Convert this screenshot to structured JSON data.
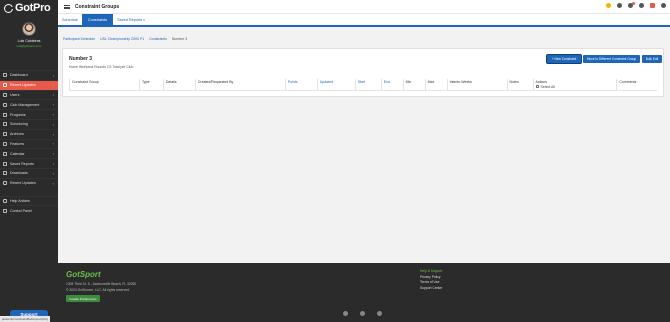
{
  "sidebar": {
    "logo_text": "GotPro",
    "user_name": "Luis Caldeiras",
    "user_email": "luis@gotsport.com",
    "items": [
      {
        "label": "Dashboard",
        "icon": "grid-icon",
        "active": false
      },
      {
        "label": "Recent Updates",
        "icon": "clock-icon",
        "active": true
      },
      {
        "label": "Users",
        "icon": "users-icon",
        "active": false
      },
      {
        "label": "Club Management",
        "icon": "shield-icon",
        "active": false
      },
      {
        "label": "Programs",
        "icon": "flag-icon",
        "active": false
      },
      {
        "label": "Scheduling",
        "icon": "calendar-icon",
        "active": false
      },
      {
        "label": "Archives",
        "icon": "archive-icon",
        "active": false
      },
      {
        "label": "Features",
        "icon": "star-icon",
        "active": false
      },
      {
        "label": "Calendar",
        "icon": "calendar-icon",
        "active": false
      },
      {
        "label": "Saved Reports",
        "icon": "report-icon",
        "active": false
      },
      {
        "label": "Downloads",
        "icon": "download-icon",
        "active": false
      },
      {
        "label": "Recent Updates",
        "icon": "clock-icon",
        "active": false
      }
    ],
    "extra_items": [
      {
        "label": "Help Articles",
        "icon": "help-icon"
      },
      {
        "label": "Control Panel",
        "icon": "gear-icon"
      }
    ],
    "support_label": "Support"
  },
  "topbar": {
    "title": "Constraint Groups"
  },
  "tabs": [
    {
      "label": "Schedule",
      "active": false
    },
    {
      "label": "Constraints",
      "active": true
    },
    {
      "label": "Saved Reports",
      "active": false,
      "dropdown": true
    }
  ],
  "breadcrumb": [
    "Participant Schedule",
    "USL Championship 2000 P1",
    "Constraints",
    "Number 3"
  ],
  "card": {
    "title": "Number 3",
    "subtitle": "Home Weekend Rounds CS Total per Club",
    "buttons": {
      "new_constraint": "+ New Constraint",
      "move": "Move to Different Constraint Group",
      "bulk_edit": "Bulk Edit"
    }
  },
  "table": {
    "columns": [
      "Constraint Group",
      "Type",
      "Details",
      "Created/Requested By",
      "Points",
      "Updated",
      "Start",
      "End",
      "Min",
      "Max",
      "Interim Weeks",
      "Notes",
      "Actions",
      "Comments"
    ],
    "link_columns": [
      "Points",
      "Updated",
      "Start",
      "End"
    ],
    "select_all_label": "Select All"
  },
  "footer": {
    "brand_a": "Got",
    "brand_b": "Sport",
    "address": "1305 Third St. S., Jacksonville Beach, FL 32250",
    "copyright": "© 2024 GotSoccer, LLC. All rights reserved.",
    "cookie_button": "Cookie Preferences",
    "links_header": "Help & Support",
    "links": [
      "Privacy Policy",
      "Terms of Use",
      "Support Center"
    ]
  },
  "status_bar": "javascript:constraintModal.open(this);"
}
